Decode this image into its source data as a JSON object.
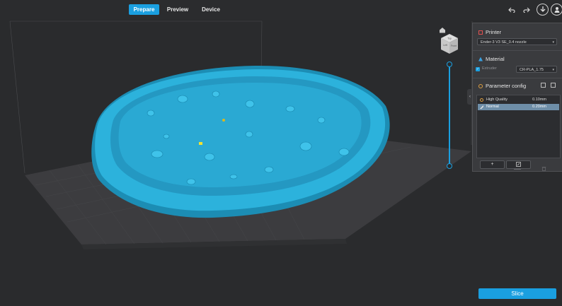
{
  "tabs": [
    {
      "label": "Prepare",
      "active": true
    },
    {
      "label": "Preview",
      "active": false
    },
    {
      "label": "Device",
      "active": false
    }
  ],
  "toolbar_icons": [
    "undo-icon",
    "redo-icon",
    "download-icon",
    "user-icon"
  ],
  "view_cube": {
    "faces": [
      "Top",
      "Front",
      "Left"
    ],
    "home_icon": "home-icon"
  },
  "panel": {
    "printer": {
      "title": "Printer",
      "selected": "Ender-3 V3 SE_0.4 nozzle"
    },
    "material": {
      "title": "Material",
      "extruder_label": "Extruder",
      "extruder_checked": true,
      "selected": "CR-PLA_1.75"
    },
    "parameter_config": {
      "title": "Parameter config",
      "profiles": [
        {
          "name": "High Quality",
          "value": "0.10mm",
          "selected": false
        },
        {
          "name": "Normal",
          "value": "0.20mm",
          "selected": true
        }
      ],
      "buttons": [
        "+",
        "edit",
        "delete"
      ]
    }
  },
  "slice_button": {
    "label": "Slice"
  },
  "colors": {
    "accent": "#1a9fe0",
    "model": "#2cb2dc",
    "bed": "#3c3c3f"
  }
}
